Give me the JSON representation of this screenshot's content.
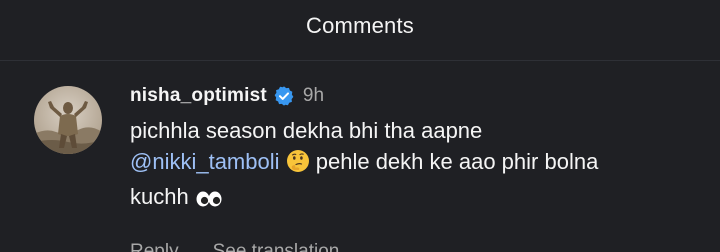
{
  "header": {
    "title": "Comments"
  },
  "comment": {
    "username": "nisha_optimist",
    "verified_icon": "verified-badge-icon",
    "time": "9h",
    "text_line1": "pichhla season dekha bhi tha aapne",
    "mention": "@nikki_tamboli",
    "text_after_mention": "pehle dekh ke aao phir bolna",
    "text_line3": "kuchh",
    "emoji_thinking": "thinking-face-icon",
    "emoji_eyes": "eyes-icon",
    "actions": {
      "reply_label": "Reply",
      "translate_label": "See translation"
    }
  },
  "colors": {
    "background": "#1f2024",
    "text_primary": "#f5f5f5",
    "text_secondary": "#a8a8a8",
    "mention": "#9ec0f5",
    "verified_blue": "#3897f0"
  }
}
